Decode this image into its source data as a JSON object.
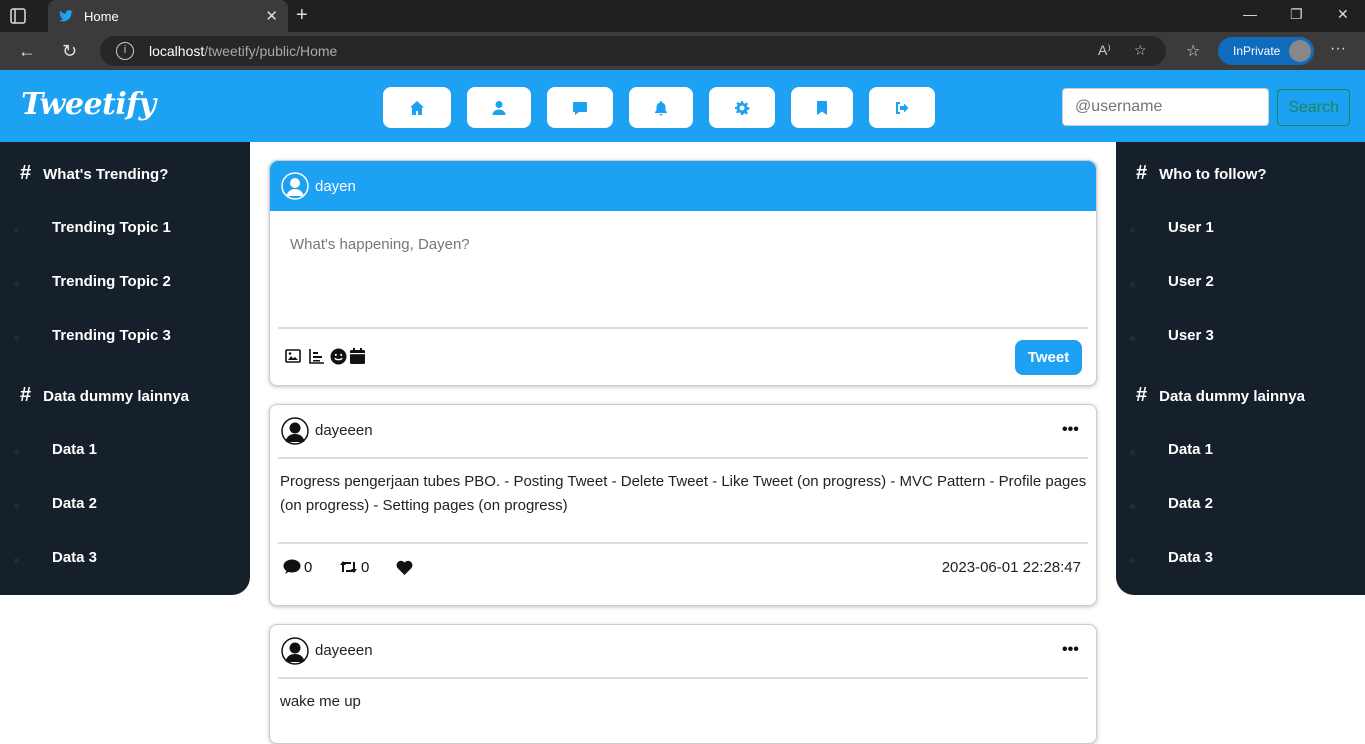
{
  "browser": {
    "tab_title": "Home",
    "url_host": "localhost",
    "url_path": "/tweetify/public/Home",
    "inprivate_label": "InPrivate"
  },
  "app": {
    "brand": "Tweetify",
    "nav_icons": [
      "home-icon",
      "user-icon",
      "comment-icon",
      "bell-icon",
      "gear-icon",
      "bookmark-icon",
      "logout-icon"
    ],
    "search_placeholder": "@username",
    "search_label": "Search",
    "accent_color": "#1da1f2",
    "sidebar_color": "#15202b"
  },
  "left_sidebar": {
    "heading1": "What's Trending?",
    "items1": [
      "Trending Topic 1",
      "Trending Topic 2",
      "Trending Topic 3"
    ],
    "heading2": "Data dummy lainnya",
    "items2": [
      "Data 1",
      "Data 2",
      "Data 3"
    ]
  },
  "right_sidebar": {
    "heading1": "Who to follow?",
    "items1": [
      "User 1",
      "User 2",
      "User 3"
    ],
    "heading2": "Data dummy lainnya",
    "items2": [
      "Data 1",
      "Data 2",
      "Data 3"
    ]
  },
  "compose": {
    "username": "dayen",
    "placeholder": "What's happening, Dayen?",
    "tweet_label": "Tweet"
  },
  "posts": [
    {
      "username": "dayeeen",
      "body": "Progress pengerjaan tubes PBO. - Posting Tweet - Delete Tweet - Like Tweet (on progress) - MVC Pattern - Profile pages (on progress) - Setting pages (on progress)",
      "comments": "0",
      "retweets": "0",
      "date": "2023-06-01 22:28:47"
    },
    {
      "username": "dayeeen",
      "body": "wake me up"
    }
  ]
}
